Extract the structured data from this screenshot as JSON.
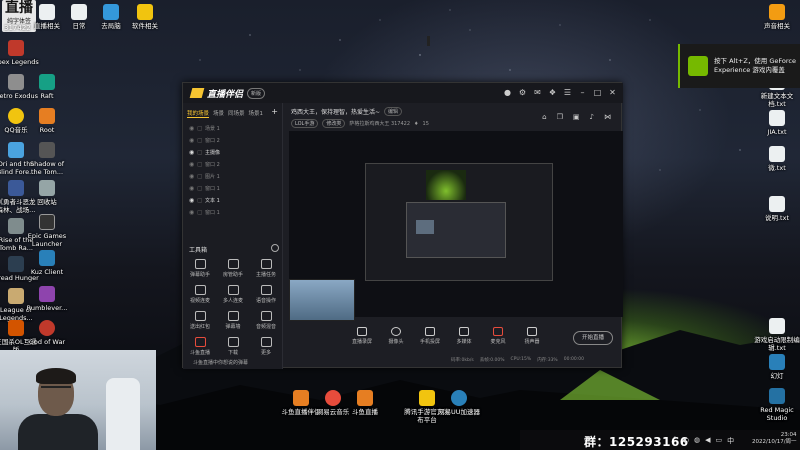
{
  "badge": {
    "title": "直播",
    "subtitle": "纯字体签",
    "number": "317422"
  },
  "desktop_left": [
    {
      "label": "Apex Legends",
      "color": "#c0392b"
    },
    {
      "label": "Metro Exodus",
      "color": "#8e8e8e"
    },
    {
      "label": "QQ音乐",
      "color": "#f1c40f"
    },
    {
      "label": "Ori and the Blind Fore...",
      "color": "#4aa3df"
    },
    {
      "label": "《勇者斗恶龙 森林、战场...",
      "color": "#3b5998"
    },
    {
      "label": "Rise of the Tomb Ra...",
      "color": "#7f8c8d"
    },
    {
      "label": "Dread Hunger",
      "color": "#2c3e50"
    },
    {
      "label": "League of Legends...",
      "color": "#c9aa71"
    },
    {
      "label": "三国杀OL互通版",
      "color": "#d35400"
    }
  ],
  "desktop_second": [
    {
      "label": "Raft",
      "color": "#16a085"
    },
    {
      "label": "Root",
      "color": "#e67e22"
    },
    {
      "label": "Shadow of the Tom...",
      "color": "#555"
    },
    {
      "label": "回收站",
      "color": "#95a5a6"
    },
    {
      "label": "Epic Games Launcher",
      "color": "#333"
    },
    {
      "label": "Kuz Client",
      "color": "#2980b9"
    },
    {
      "label": "Rumblever...",
      "color": "#8e44ad"
    },
    {
      "label": "God of War",
      "color": "#c0392b"
    }
  ],
  "desktop_top": [
    {
      "label": "直播相关",
      "color": "#ecf0f1"
    },
    {
      "label": "日常",
      "color": "#ecf0f1"
    },
    {
      "label": "去局脑",
      "color": "#3498db"
    },
    {
      "label": "软件相关",
      "color": "#f1c40f"
    }
  ],
  "desktop_right": [
    {
      "label": "声音相关",
      "color": "#f39c12"
    },
    {
      "label": "新建文本文档.txt",
      "color": "#ecf0f1"
    },
    {
      "label": "JIA.txt",
      "color": "#ecf0f1"
    },
    {
      "label": "微.txt",
      "color": "#ecf0f1"
    },
    {
      "label": "说明.txt",
      "color": "#ecf0f1"
    },
    {
      "label": "游戏启动限制编辑.txt",
      "color": "#ecf0f1"
    },
    {
      "label": "幻灯",
      "color": "#2980b9"
    },
    {
      "label": "Red Magic Studio",
      "color": "#2471a3"
    }
  ],
  "desktop_bottom": [
    {
      "label": "斗鱼直播伴侣",
      "color": "#e67e22"
    },
    {
      "label": "网易云音乐",
      "color": "#e74c3c"
    },
    {
      "label": "斗鱼直播",
      "color": "#e67e22"
    },
    {
      "label": "腾讯手游官方发布平台",
      "color": "#f1c40f"
    },
    {
      "label": "网易UU加速器",
      "color": "#2980b9"
    }
  ],
  "nvidia": {
    "line1": "按下 Alt+Z，使用 GeForce",
    "line2": "Experience 游戏内覆盖"
  },
  "app": {
    "title": "直播伴侣",
    "version": "新版",
    "tabs": [
      "我的场景",
      "场景",
      "同场景",
      "场景1"
    ],
    "layers": [
      {
        "label": "场景 1",
        "on": false
      },
      {
        "label": "窗口 2",
        "on": false
      },
      {
        "label": "主摄像",
        "on": true
      },
      {
        "label": "窗口 2",
        "on": false
      },
      {
        "label": "图片 1",
        "on": false
      },
      {
        "label": "窗口 1",
        "on": false
      },
      {
        "label": "文本 1",
        "on": true
      },
      {
        "label": "窗口 1",
        "on": false
      }
    ],
    "tools_heading": "工具箱",
    "tools": [
      "弹幕助手",
      "房管助手",
      "主播任务",
      "视频连麦",
      "多人连麦",
      "语音操作",
      "送出红包",
      "弹幕墙",
      "音频混音",
      "斗鱼直播",
      "下载",
      "更多"
    ],
    "bottom_note": "斗鱼直播中你想说的弹幕",
    "stream_title": "鸡西大王，保持理智，热爱生活~",
    "edit_label": "编辑",
    "category": "LOL手游",
    "category_tag": "修改类",
    "room_line": "萨格拉斯鸡西大王  317422",
    "fans": "15",
    "controls": [
      "直播录屏",
      "摄像头",
      "手机投屏",
      "多媒体",
      "麦克风",
      "扬声器"
    ],
    "start_label": "开始直播",
    "stats": [
      "码率:0kb/s",
      "丢帧:0.00%",
      "CPU:15%",
      "内存:33%",
      "00:00:00"
    ]
  },
  "taskbar": {
    "group_label": "群：125293166",
    "time": "23:04",
    "date": "2022/10/17/周一"
  }
}
